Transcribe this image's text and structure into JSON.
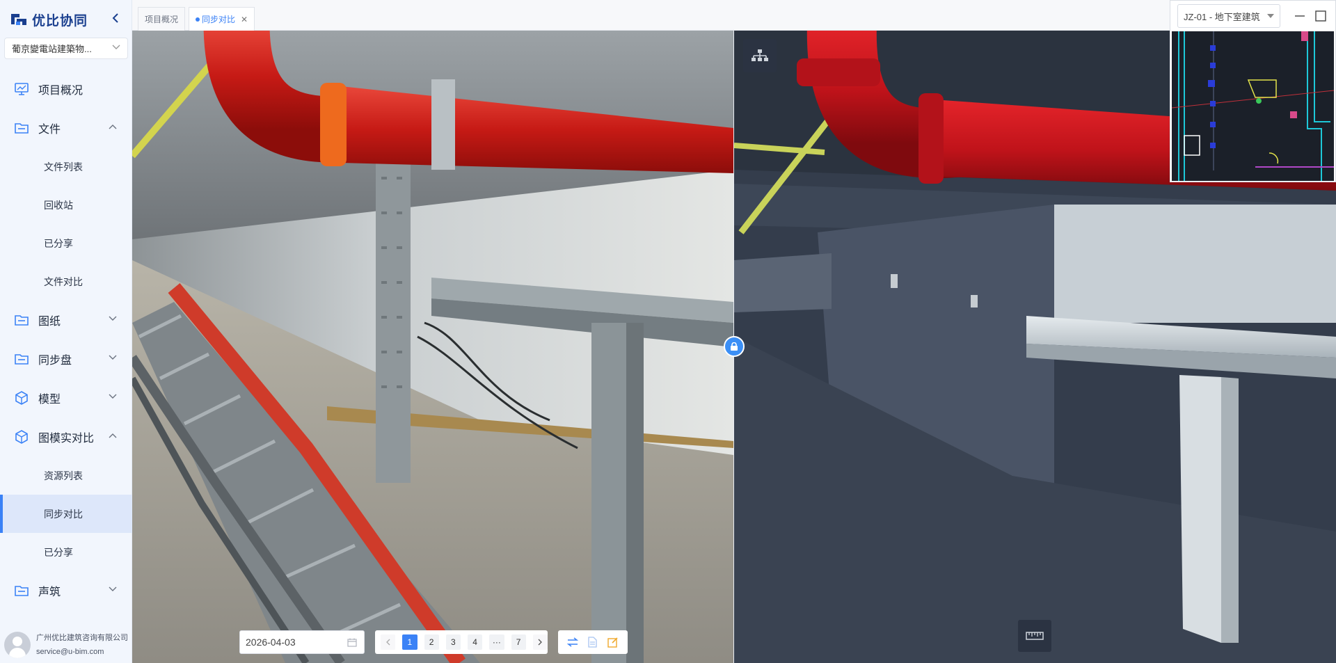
{
  "app": {
    "logo_text": "优比协同"
  },
  "project": {
    "selected": "葡京變電站建築物..."
  },
  "menu": {
    "overview": "项目概况",
    "files": "文件",
    "files_sub": [
      "文件列表",
      "回收站",
      "已分享",
      "文件对比"
    ],
    "drawings": "图纸",
    "sync_disk": "同步盘",
    "model": "模型",
    "compare": "图模实对比",
    "compare_sub": [
      "资源列表",
      "同步对比",
      "已分享"
    ],
    "acoustic": "声筑"
  },
  "user": {
    "company": "广州优比建筑咨询有限公司",
    "email": "service@u-bim.com"
  },
  "tabs": [
    {
      "label": "项目概况",
      "active": false
    },
    {
      "label": "同步对比",
      "active": true
    }
  ],
  "floor": {
    "selected": "JZ-01 - 地下室建筑"
  },
  "toolbar": {
    "date": "2026-04-03",
    "pages": [
      "1",
      "2",
      "3",
      "4",
      "···",
      "7"
    ],
    "current_page": "1"
  },
  "colors": {
    "accent": "#3b82f6",
    "pipe_red": "#c8141c",
    "model_bg": "#333d4e"
  },
  "icons": {
    "tree": "hierarchy-icon",
    "measure": "ruler-icon",
    "lock": "lock-icon",
    "swap": "swap-icon",
    "doc": "document-icon",
    "edit": "edit-icon"
  }
}
